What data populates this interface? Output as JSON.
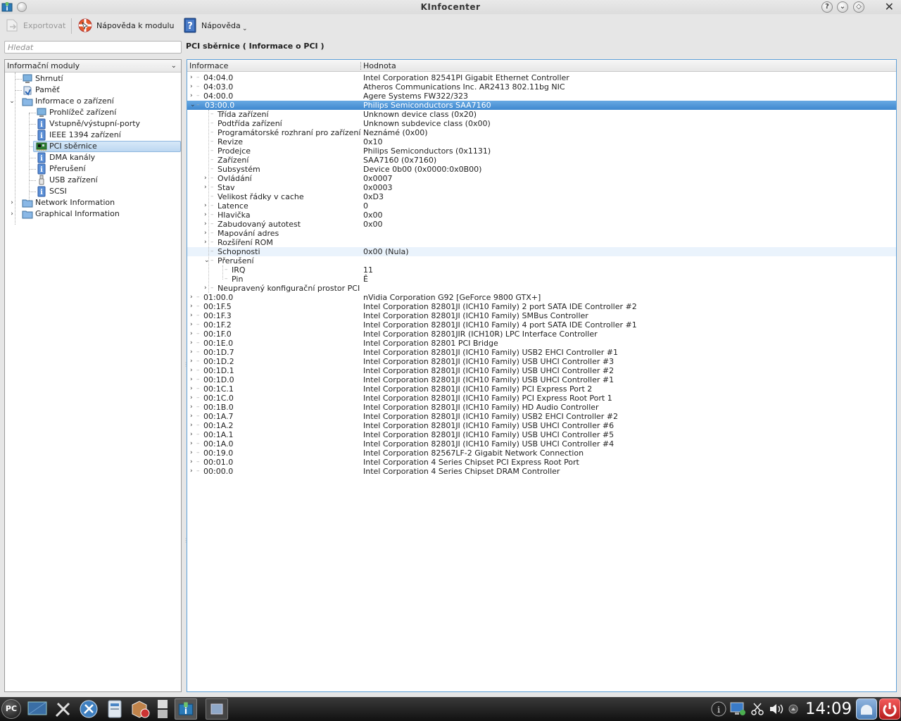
{
  "window": {
    "title": "KInfocenter"
  },
  "toolbar": {
    "export_label": "Exportovat",
    "module_help_label": "Nápověda k modulu",
    "help_label": "Nápověda"
  },
  "search": {
    "placeholder": "Hledat"
  },
  "module_title": "PCI sběrnice  ( Informace o PCI )",
  "sidebar": {
    "combo_label": "Informační moduly",
    "items": [
      {
        "label": "Shrnutí"
      },
      {
        "label": "Paměť"
      },
      {
        "label": "Informace o zařízení"
      },
      {
        "label": "Prohlížeč zařízení"
      },
      {
        "label": "Vstupně/výstupní-porty"
      },
      {
        "label": "IEEE 1394 zařízení"
      },
      {
        "label": "PCI sběrnice"
      },
      {
        "label": "DMA kanály"
      },
      {
        "label": "Přerušení"
      },
      {
        "label": "USB zařízení"
      },
      {
        "label": "SCSI"
      },
      {
        "label": "Network Information"
      },
      {
        "label": "Graphical Information"
      }
    ]
  },
  "table": {
    "col_info": "Informace",
    "col_value": "Hodnota",
    "rows": [
      {
        "k": "04:04.0",
        "v": "Intel Corporation 82541PI Gigabit Ethernet Controller"
      },
      {
        "k": "04:03.0",
        "v": "Atheros Communications Inc. AR2413 802.11bg NIC"
      },
      {
        "k": "04:00.0",
        "v": "Agere Systems FW322/323"
      },
      {
        "k": "03:00.0",
        "v": "Philips Semiconductors SAA7160"
      },
      {
        "k": "Třída zařízení",
        "v": "Unknown device class (0x20)"
      },
      {
        "k": "Podtřída zařízení",
        "v": "Unknown subdevice class (0x00)"
      },
      {
        "k": "Programátorské rozhraní pro zařízení",
        "v": "Neznámé (0x00)"
      },
      {
        "k": "Revize",
        "v": "0x10"
      },
      {
        "k": "Prodejce",
        "v": "Philips Semiconductors (0x1131)"
      },
      {
        "k": "Zařízení",
        "v": "SAA7160 (0x7160)"
      },
      {
        "k": "Subsystém",
        "v": "Device 0b00 (0x0000:0x0B00)"
      },
      {
        "k": "Ovládání",
        "v": "0x0007"
      },
      {
        "k": "Stav",
        "v": "0x0003"
      },
      {
        "k": "Velikost řádky v cache",
        "v": "0xD3"
      },
      {
        "k": "Latence",
        "v": "0"
      },
      {
        "k": "Hlavička",
        "v": "0x00"
      },
      {
        "k": "Zabudovaný autotest",
        "v": "0x00"
      },
      {
        "k": "Mapování adres",
        "v": ""
      },
      {
        "k": "Rozšíření ROM",
        "v": ""
      },
      {
        "k": "Schopnosti",
        "v": "0x00 (Nula)"
      },
      {
        "k": "Přerušení",
        "v": ""
      },
      {
        "k": "IRQ",
        "v": "11"
      },
      {
        "k": "Pin",
        "v": "Ê"
      },
      {
        "k": "Neupravený konfigurační prostor PCI",
        "v": ""
      },
      {
        "k": "01:00.0",
        "v": "nVidia Corporation G92 [GeForce 9800 GTX+]"
      },
      {
        "k": "00:1F.5",
        "v": "Intel Corporation 82801JI (ICH10 Family) 2 port SATA IDE Controller #2"
      },
      {
        "k": "00:1F.3",
        "v": "Intel Corporation 82801JI (ICH10 Family) SMBus Controller"
      },
      {
        "k": "00:1F.2",
        "v": "Intel Corporation 82801JI (ICH10 Family) 4 port SATA IDE Controller #1"
      },
      {
        "k": "00:1F.0",
        "v": "Intel Corporation 82801JIR (ICH10R) LPC Interface Controller"
      },
      {
        "k": "00:1E.0",
        "v": "Intel Corporation 82801 PCI Bridge"
      },
      {
        "k": "00:1D.7",
        "v": "Intel Corporation 82801JI (ICH10 Family) USB2 EHCI Controller #1"
      },
      {
        "k": "00:1D.2",
        "v": "Intel Corporation 82801JI (ICH10 Family) USB UHCI Controller #3"
      },
      {
        "k": "00:1D.1",
        "v": "Intel Corporation 82801JI (ICH10 Family) USB UHCI Controller #2"
      },
      {
        "k": "00:1D.0",
        "v": "Intel Corporation 82801JI (ICH10 Family) USB UHCI Controller #1"
      },
      {
        "k": "00:1C.1",
        "v": "Intel Corporation 82801JI (ICH10 Family) PCI Express Port 2"
      },
      {
        "k": "00:1C.0",
        "v": "Intel Corporation 82801JI (ICH10 Family) PCI Express Root Port 1"
      },
      {
        "k": "00:1B.0",
        "v": "Intel Corporation 82801JI (ICH10 Family) HD Audio Controller"
      },
      {
        "k": "00:1A.7",
        "v": "Intel Corporation 82801JI (ICH10 Family) USB2 EHCI Controller #2"
      },
      {
        "k": "00:1A.2",
        "v": "Intel Corporation 82801JI (ICH10 Family) USB UHCI Controller #6"
      },
      {
        "k": "00:1A.1",
        "v": "Intel Corporation 82801JI (ICH10 Family) USB UHCI Controller #5"
      },
      {
        "k": "00:1A.0",
        "v": "Intel Corporation 82801JI (ICH10 Family) USB UHCI Controller #4"
      },
      {
        "k": "00:19.0",
        "v": "Intel Corporation 82567LF-2 Gigabit Network Connection"
      },
      {
        "k": "00:01.0",
        "v": "Intel Corporation 4 Series Chipset PCI Express Root Port"
      },
      {
        "k": "00:00.0",
        "v": "Intel Corporation 4 Series Chipset DRAM Controller"
      }
    ]
  },
  "taskbar": {
    "launcher_label": "PC",
    "clock": "14:09"
  },
  "colors": {
    "selection": "#4a90d9",
    "accent_border": "#5ea0d8",
    "taskbar": "#1c1c1c"
  }
}
